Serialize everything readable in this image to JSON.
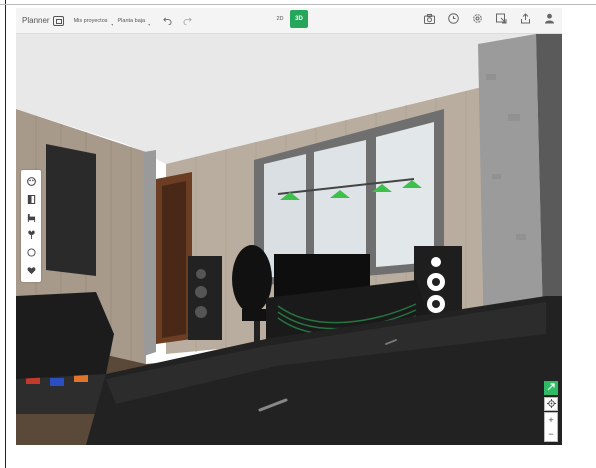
{
  "app": {
    "name": "Planner",
    "logo_icon": "planner-logo-icon"
  },
  "toolbar": {
    "menus": [
      "Mis proyectos",
      "Planta baja"
    ],
    "undo_icon": "undo-icon",
    "redo_icon": "redo-icon",
    "mode_2d_label": "2D",
    "mode_3d_label": "3D",
    "active_mode": "3D",
    "right_icons": [
      "camera-icon",
      "clock-icon",
      "settings-icon",
      "export-icon",
      "share-icon",
      "user-icon"
    ]
  },
  "side_panel": {
    "tools": [
      "palette-icon",
      "door-icon",
      "furniture-icon",
      "plant-icon",
      "circle-icon",
      "heart-icon"
    ]
  },
  "view_controls": {
    "fullscreen_icon": "fullscreen-icon",
    "locate_icon": "locate-icon",
    "zoom_in": "+",
    "zoom_out": "−"
  },
  "colors": {
    "accent": "#26a65b",
    "ceiling": "#eaeaea",
    "wall_wood": "#b7aa9b",
    "window_frame": "#6d6d6d",
    "floor": "#5a4838",
    "lamp": "#3ec04d",
    "furniture": "#1c1c1c"
  }
}
